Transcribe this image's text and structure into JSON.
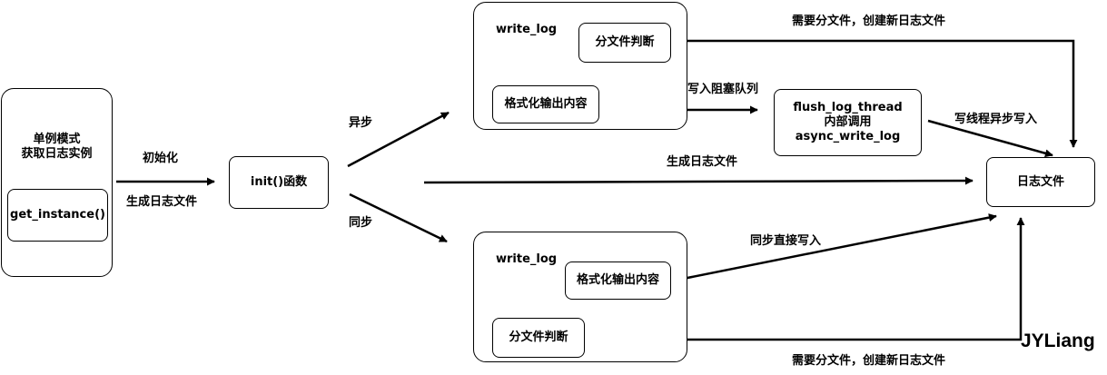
{
  "nodes": {
    "singleton_title": "单例模式\n获取日志实例",
    "get_instance": "get_instance()",
    "init": "init()函数",
    "async_group_title": "write_log",
    "async_split": "分文件判断",
    "async_format": "格式化输出内容",
    "flush_thread": "flush_log_thread\n内部调用\nasync_write_log",
    "log_file": "日志文件",
    "sync_group_title": "write_log",
    "sync_format": "格式化输出内容",
    "sync_split": "分文件判断"
  },
  "edges": {
    "init_label": "初始化",
    "gen_file_left": "生成日志文件",
    "async_label": "异步",
    "sync_label": "同步",
    "to_queue": "写入阻塞队列",
    "thread_write": "写线程异步写入",
    "gen_file_mid": "生成日志文件",
    "split_new_top": "需要分文件，创建新日志文件",
    "sync_direct": "同步直接写入",
    "split_new_bottom": "需要分文件，创建新日志文件"
  },
  "watermark": "JYLiang"
}
